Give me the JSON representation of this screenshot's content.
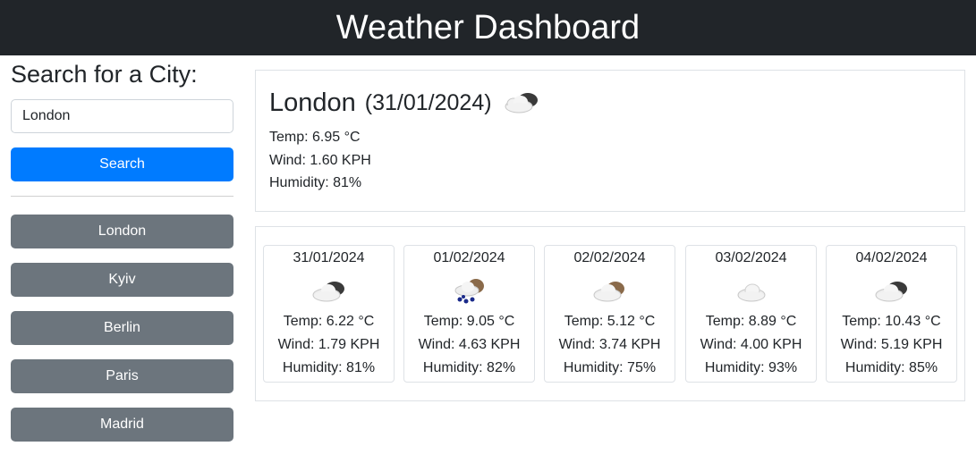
{
  "header": {
    "title": "Weather Dashboard"
  },
  "sidebar": {
    "heading": "Search for a City:",
    "input_value": "London",
    "search_label": "Search",
    "history": [
      "London",
      "Kyiv",
      "Berlin",
      "Paris",
      "Madrid"
    ]
  },
  "today": {
    "city": "London",
    "date": "(31/01/2024)",
    "icon": "partly-cloudy-icon",
    "temp": "Temp: 6.95 °C",
    "wind": "Wind: 1.60 KPH",
    "humidity": "Humidity: 81%"
  },
  "forecast": [
    {
      "date": "31/01/2024",
      "icon": "cloudy-icon",
      "temp": "Temp: 6.22 °C",
      "wind": "Wind: 1.79 KPH",
      "humidity": "Humidity: 81%"
    },
    {
      "date": "01/02/2024",
      "icon": "rain-icon",
      "temp": "Temp: 9.05 °C",
      "wind": "Wind: 4.63 KPH",
      "humidity": "Humidity: 82%"
    },
    {
      "date": "02/02/2024",
      "icon": "partly-cloudy-icon",
      "temp": "Temp: 5.12 °C",
      "wind": "Wind: 3.74 KPH",
      "humidity": "Humidity: 75%"
    },
    {
      "date": "03/02/2024",
      "icon": "cloud-icon",
      "temp": "Temp: 8.89 °C",
      "wind": "Wind: 4.00 KPH",
      "humidity": "Humidity: 93%"
    },
    {
      "date": "04/02/2024",
      "icon": "cloudy-icon",
      "temp": "Temp: 10.43 °C",
      "wind": "Wind: 5.19 KPH",
      "humidity": "Humidity: 85%"
    }
  ],
  "colors": {
    "header_bg": "#212529",
    "primary": "#007bff",
    "secondary": "#6c757d",
    "border": "#dee2e6"
  }
}
